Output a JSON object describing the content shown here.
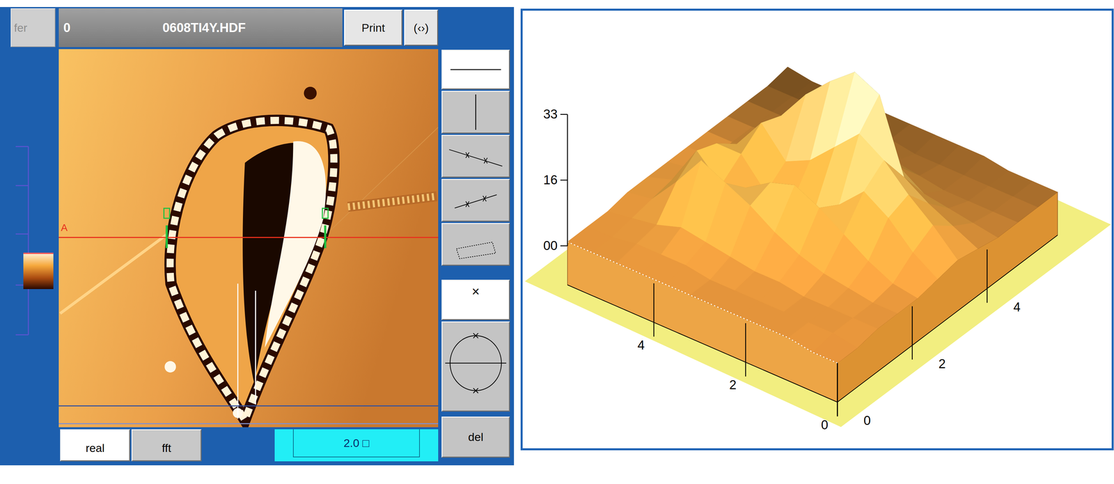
{
  "title_bar": {
    "transfer_button": {
      "label": "fer",
      "disabled": true
    },
    "frame": "0",
    "file": "0608TI4Y.HDF",
    "buttons": [
      "Print",
      "(‹›)"
    ]
  },
  "image_view": {
    "profile_label": "A"
  },
  "tools": [
    {
      "kind": "horizontal-line",
      "selected": true
    },
    {
      "kind": "vertical-line",
      "selected": false
    },
    {
      "kind": "line-segment",
      "selected": false
    },
    {
      "kind": "short-segment",
      "selected": false
    },
    {
      "kind": "rectangle",
      "selected": false
    }
  ],
  "marker_tools": [
    {
      "kind": "point",
      "label": "×",
      "selected": true
    },
    {
      "kind": "ellipse",
      "selected": false
    }
  ],
  "del_button": "del",
  "view_tabs": [
    {
      "label": "real",
      "selected": true
    },
    {
      "label": "fft",
      "selected": false
    }
  ],
  "scale_readout": "2.0 □",
  "surface_plot": {
    "z_ticks": [
      "00",
      "16",
      "33"
    ],
    "left_axis_ticks": [
      "0",
      "2",
      "4"
    ],
    "right_axis_ticks": [
      "0",
      "2",
      "4"
    ],
    "heights": [
      [
        0,
        0,
        1,
        1,
        1,
        2,
        3,
        2,
        1,
        1,
        1,
        1
      ],
      [
        0,
        1,
        1,
        1,
        2,
        6,
        9,
        5,
        2,
        1,
        1,
        1
      ],
      [
        1,
        1,
        1,
        2,
        5,
        12,
        14,
        8,
        3,
        1,
        1,
        1
      ],
      [
        1,
        1,
        1,
        3,
        9,
        16,
        20,
        12,
        4,
        1,
        1,
        2
      ],
      [
        1,
        1,
        2,
        5,
        13,
        10,
        24,
        30,
        8,
        2,
        1,
        2
      ],
      [
        1,
        1,
        2,
        8,
        16,
        6,
        18,
        33,
        14,
        3,
        1,
        2
      ],
      [
        1,
        1,
        3,
        12,
        14,
        4,
        12,
        28,
        20,
        4,
        2,
        2
      ],
      [
        1,
        2,
        4,
        15,
        10,
        5,
        9,
        22,
        18,
        5,
        2,
        2
      ],
      [
        1,
        2,
        5,
        18,
        8,
        12,
        16,
        14,
        8,
        3,
        2,
        2
      ],
      [
        1,
        2,
        3,
        10,
        14,
        12,
        8,
        4,
        3,
        2,
        2,
        2
      ],
      [
        1,
        1,
        2,
        3,
        4,
        3,
        2,
        2,
        2,
        2,
        2,
        2
      ],
      [
        1,
        1,
        1,
        2,
        2,
        2,
        2,
        2,
        2,
        2,
        2,
        3
      ]
    ]
  }
}
